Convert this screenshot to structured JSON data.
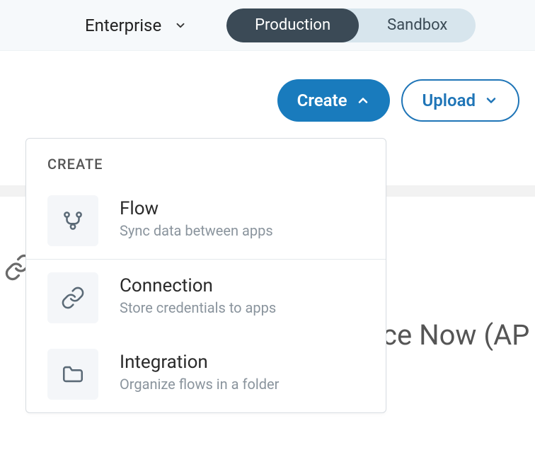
{
  "topbar": {
    "workspace_label": "Enterprise",
    "env_production": "Production",
    "env_sandbox": "Sandbox"
  },
  "actions": {
    "create_label": "Create",
    "upload_label": "Upload"
  },
  "background": {
    "partial_title": "ce Now (AP"
  },
  "create_menu": {
    "heading": "CREATE",
    "items": [
      {
        "title": "Flow",
        "desc": "Sync data between apps",
        "icon": "branch-icon"
      },
      {
        "title": "Connection",
        "desc": "Store credentials to apps",
        "icon": "link-icon"
      },
      {
        "title": "Integration",
        "desc": "Organize flows in a folder",
        "icon": "folder-icon"
      }
    ]
  }
}
